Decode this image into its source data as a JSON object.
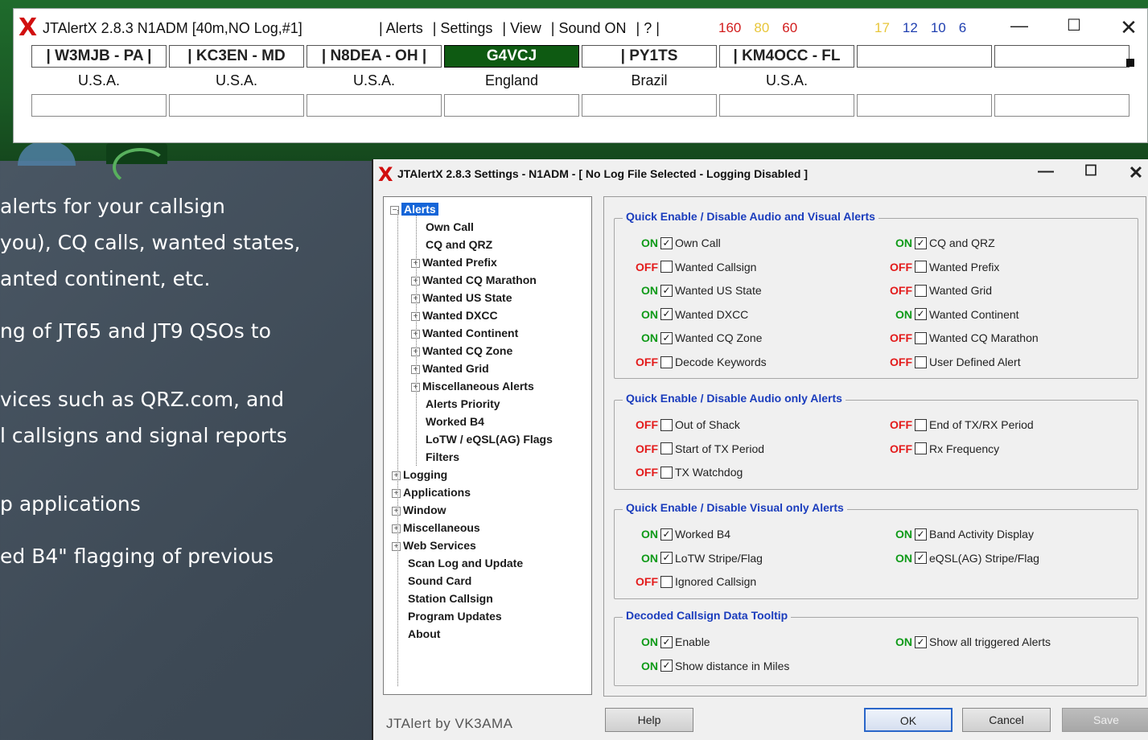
{
  "top_window": {
    "app_title": "JTAlertX 2.8.3 N1ADM [40m,NO Log,#1]",
    "menu": [
      "| Alerts",
      "| Settings",
      "| View",
      "| Sound ON",
      "| ? |"
    ],
    "counts_red": [
      "160",
      "80",
      "60"
    ],
    "counts_blue": [
      "17",
      "12",
      "10",
      "6"
    ],
    "cells": [
      {
        "call": "|  W3MJB - PA  |",
        "country": "U.S.A.",
        "highlight": false
      },
      {
        "call": "|  KC3EN - MD",
        "country": "U.S.A.",
        "highlight": false
      },
      {
        "call": "|  N8DEA - OH  |",
        "country": "U.S.A.",
        "highlight": false
      },
      {
        "call": "G4VCJ",
        "country": "England",
        "highlight": true
      },
      {
        "call": "|  PY1TS",
        "country": "Brazil",
        "highlight": false
      },
      {
        "call": "|  KM4OCC - FL",
        "country": "U.S.A.",
        "highlight": false
      },
      {
        "call": "",
        "country": "",
        "highlight": false
      },
      {
        "call": "",
        "country": "",
        "highlight": false
      }
    ]
  },
  "slide_text": [
    "alerts for your callsign",
    "you), CQ calls, wanted states,",
    "anted continent, etc.",
    "ng of JT65 and JT9 QSOs to",
    "vices such as QRZ.com, and",
    "l callsigns and signal reports",
    "p applications",
    "ed B4\" flagging of previous"
  ],
  "settings_dialog": {
    "title": "JTAlertX 2.8.3 Settings  -  N1ADM  -  [ No Log File Selected - Logging Disabled ]",
    "tree": {
      "root_selected": "Alerts",
      "alerts_children": [
        "Own Call",
        "CQ and QRZ",
        "Wanted Prefix",
        "Wanted CQ Marathon",
        "Wanted US State",
        "Wanted DXCC",
        "Wanted Continent",
        "Wanted CQ Zone",
        "Wanted Grid",
        "Miscellaneous Alerts",
        "Alerts Priority",
        "Worked B4",
        "LoTW / eQSL(AG) Flags",
        "Filters"
      ],
      "top_nodes": [
        "Logging",
        "Applications",
        "Window",
        "Miscellaneous",
        "Web Services"
      ],
      "leaf_nodes": [
        "Scan Log and Update",
        "Sound Card",
        "Station Callsign",
        "Program Updates",
        "About"
      ]
    },
    "groups": {
      "audio_visual": {
        "title": "Quick Enable / Disable Audio and Visual Alerts",
        "left": [
          {
            "state": "ON",
            "checked": true,
            "label": "Own Call"
          },
          {
            "state": "OFF",
            "checked": false,
            "label": "Wanted Callsign"
          },
          {
            "state": "ON",
            "checked": true,
            "label": "Wanted US State"
          },
          {
            "state": "ON",
            "checked": true,
            "label": "Wanted DXCC"
          },
          {
            "state": "ON",
            "checked": true,
            "label": "Wanted CQ Zone"
          },
          {
            "state": "OFF",
            "checked": false,
            "label": "Decode Keywords"
          }
        ],
        "right": [
          {
            "state": "ON",
            "checked": true,
            "label": "CQ and QRZ"
          },
          {
            "state": "OFF",
            "checked": false,
            "label": "Wanted Prefix"
          },
          {
            "state": "OFF",
            "checked": false,
            "label": "Wanted Grid"
          },
          {
            "state": "ON",
            "checked": true,
            "label": "Wanted Continent"
          },
          {
            "state": "OFF",
            "checked": false,
            "label": "Wanted CQ Marathon"
          },
          {
            "state": "OFF",
            "checked": false,
            "label": "User Defined Alert"
          }
        ]
      },
      "audio_only": {
        "title": "Quick Enable / Disable Audio only Alerts",
        "left": [
          {
            "state": "OFF",
            "checked": false,
            "label": "Out of Shack"
          },
          {
            "state": "OFF",
            "checked": false,
            "label": "Start of TX Period"
          },
          {
            "state": "OFF",
            "checked": false,
            "label": "TX Watchdog"
          }
        ],
        "right": [
          {
            "state": "OFF",
            "checked": false,
            "label": "End of TX/RX Period"
          },
          {
            "state": "OFF",
            "checked": false,
            "label": "Rx Frequency"
          }
        ]
      },
      "visual_only": {
        "title": "Quick Enable / Disable Visual only Alerts",
        "left": [
          {
            "state": "ON",
            "checked": true,
            "label": "Worked B4"
          },
          {
            "state": "ON",
            "checked": true,
            "label": "LoTW Stripe/Flag"
          },
          {
            "state": "OFF",
            "checked": false,
            "label": "Ignored Callsign"
          }
        ],
        "right": [
          {
            "state": "ON",
            "checked": true,
            "label": "Band Activity Display"
          },
          {
            "state": "ON",
            "checked": true,
            "label": "eQSL(AG) Stripe/Flag"
          }
        ]
      },
      "tooltip": {
        "title": "Decoded Callsign Data Tooltip",
        "left": [
          {
            "state": "ON",
            "checked": true,
            "label": "Enable"
          },
          {
            "state": "ON",
            "checked": true,
            "label": "Show distance in Miles"
          }
        ],
        "right": [
          {
            "state": "ON",
            "checked": true,
            "label": "Show all triggered Alerts"
          }
        ]
      }
    },
    "footer_label": "JTAlert by VK3AMA",
    "buttons": {
      "help": "Help",
      "ok": "OK",
      "cancel": "Cancel",
      "save": "Save"
    }
  },
  "colors": {
    "on": "#0f9a18",
    "off": "#e31b1b",
    "group_title": "#1b3dbd",
    "highlight_cell": "#0e5a12",
    "count_red": "#d21c1c",
    "count_blue": "#1f3fb0"
  }
}
